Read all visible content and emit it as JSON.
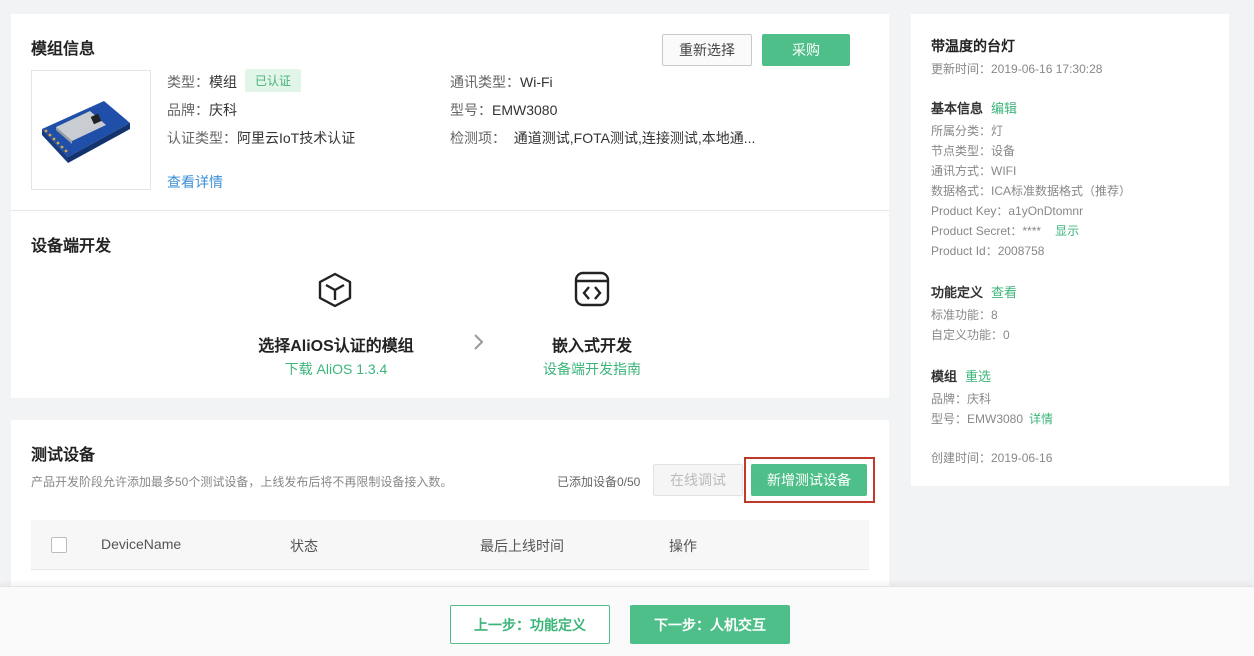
{
  "module": {
    "title": "模组信息",
    "reselect": "重新选择",
    "buy": "采购",
    "type_label": "类型：",
    "type_value": "模组",
    "certified_badge": "已认证",
    "brand_label": "品牌：",
    "brand_value": "庆科",
    "cert_label": "认证类型：",
    "cert_value": "阿里云IoT技术认证",
    "comm_label": "通讯类型：",
    "comm_value": "Wi-Fi",
    "model_label": "型号：",
    "model_value": "EMW3080",
    "test_label": "检测项：",
    "test_value": "通道测试,FOTA测试,连接测试,本地通...",
    "detail_link": "查看详情"
  },
  "device_dev": {
    "title": "设备端开发",
    "step1_title": "选择AliOS认证的模组",
    "step1_link": "下载 AliOS 1.3.4",
    "step2_title": "嵌入式开发",
    "step2_link": "设备端开发指南"
  },
  "test_devices": {
    "title": "测试设备",
    "desc": "产品开发阶段允许添加最多50个测试设备，上线发布后将不再限制设备接入数。",
    "added": "已添加设备0/50",
    "online_debug": "在线调试",
    "add_button": "新增测试设备",
    "columns": [
      "DeviceName",
      "状态",
      "最后上线时间",
      "操作"
    ]
  },
  "footer": {
    "prev": "上一步：功能定义",
    "next": "下一步：人机交互"
  },
  "sidebar": {
    "title": "带温度的台灯",
    "updated": "更新时间：2019-06-16 17:30:28",
    "basic_head": "基本信息",
    "edit": "编辑",
    "category": "所属分类：灯",
    "node_type": "节点类型：设备",
    "comm": "通讯方式：WIFI",
    "data_format": "数据格式：ICA标准数据格式（推荐）",
    "product_key": "Product Key：a1yOnDtomnr",
    "product_secret": "Product Secret：****",
    "show": "显示",
    "product_id": "Product Id：2008758",
    "func_head": "功能定义",
    "view": "查看",
    "std_func": "标准功能：8",
    "custom_func": "自定义功能：0",
    "module_head": "模组",
    "reselect": "重选",
    "brand": "品牌：庆科",
    "model": "型号：EMW3080",
    "detail": "详情",
    "created": "创建时间：2019-06-16"
  },
  "colors": {
    "accent": "#4fbf8a",
    "highlight_border": "#c0392b"
  }
}
